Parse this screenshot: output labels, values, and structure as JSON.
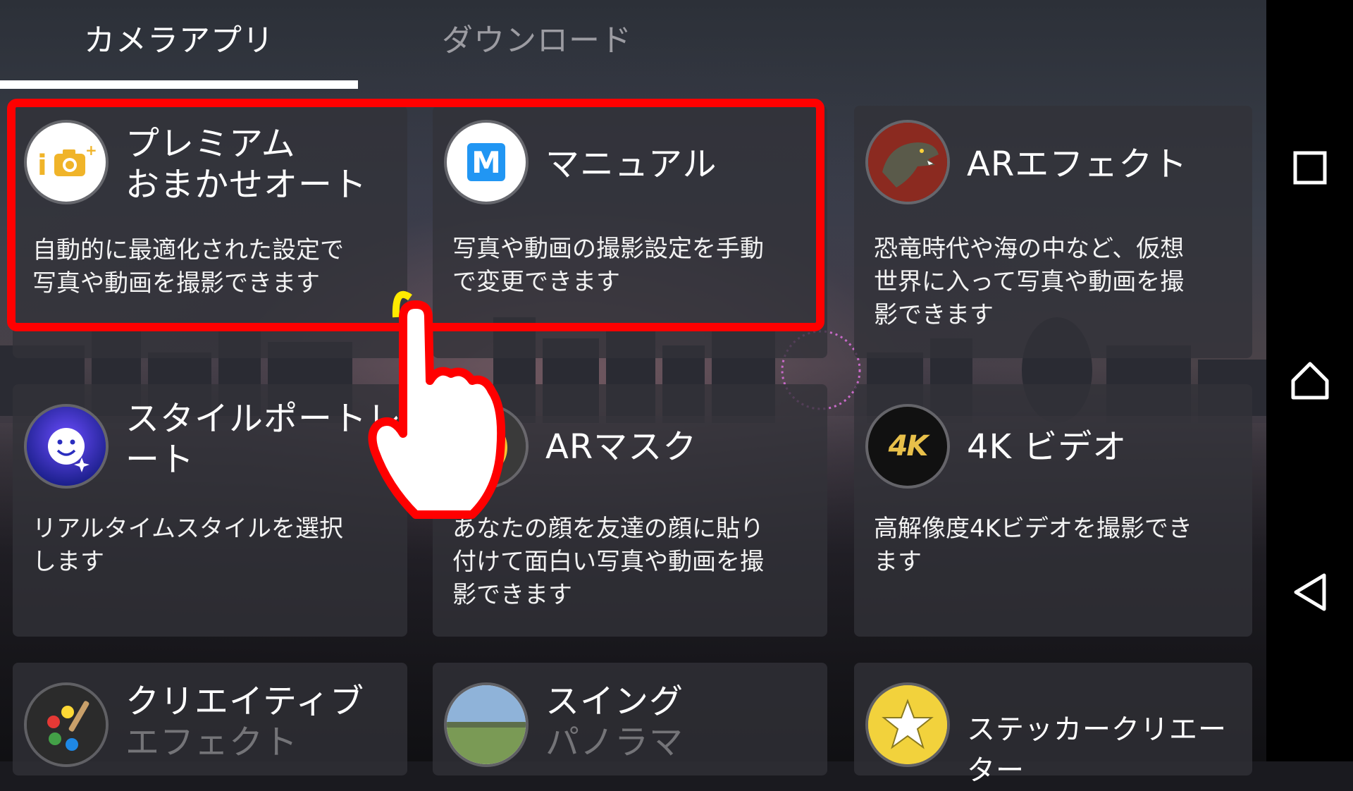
{
  "tabs": [
    {
      "label": "カメラアプリ",
      "active": true
    },
    {
      "label": "ダウンロード",
      "active": false
    }
  ],
  "apps": [
    {
      "title_line1": "プレミアム",
      "title_line2": "おまかせオート",
      "desc_line1": "自動的に最適化された設定で",
      "desc_line2": "写真や動画を撮影できます",
      "desc_line3": "",
      "icon": "camera-plus-icon",
      "icon_text": "i"
    },
    {
      "title_line1": "マニュアル",
      "title_line2": "",
      "desc_line1": "写真や動画の撮影設定を手動",
      "desc_line2": "で変更できます",
      "desc_line3": "",
      "icon": "manual-m-icon",
      "icon_text": "M"
    },
    {
      "title_line1": "ARエフェクト",
      "title_line2": "",
      "desc_line1": "恐竜時代や海の中など、仮想",
      "desc_line2": "世界に入って写真や動画を撮",
      "desc_line3": "影できます",
      "icon": "dinosaur-icon"
    },
    {
      "title_line1": "スタイルポートレ",
      "title_line2": "ート",
      "desc_line1": "リアルタイムスタイルを選択",
      "desc_line2": "します",
      "desc_line3": "",
      "icon": "smiley-sparkle-icon"
    },
    {
      "title_line1": "ARマスク",
      "title_line2": "",
      "desc_line1": "あなたの顔を友達の顔に貼り",
      "desc_line2": "付けて面白い写真や動画を撮",
      "desc_line3": "影できます",
      "icon": "mask-face-icon"
    },
    {
      "title_line1": "4K ビデオ",
      "title_line2": "",
      "desc_line1": "高解像度4Kビデオを撮影でき",
      "desc_line2": "ます",
      "desc_line3": "",
      "icon": "4k-badge-icon",
      "icon_text": "4K"
    },
    {
      "title_line1": "クリエイティブ",
      "title_line2": "エフェクト",
      "icon": "palette-brush-icon"
    },
    {
      "title_line1": "スイング",
      "title_line2": "パノラマ",
      "icon": "panorama-landscape-icon"
    },
    {
      "title_line1": "ステッカークリエーター",
      "title_line2": "",
      "icon": "star-sticker-icon"
    }
  ],
  "nav": {
    "recent": "recent-apps-square-icon",
    "home": "home-icon",
    "back": "back-triangle-icon"
  },
  "colors": {
    "highlight": "#ff0000",
    "tab_indicator": "#ffffff",
    "navbar": "#000000"
  }
}
